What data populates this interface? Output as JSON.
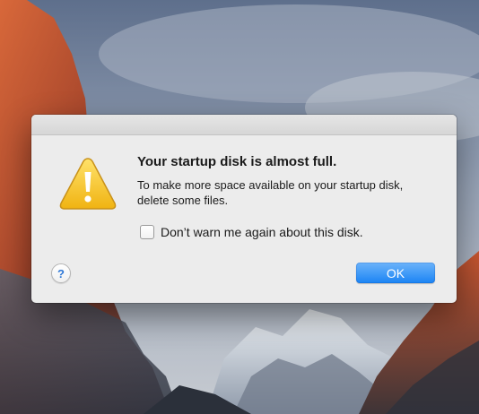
{
  "dialog": {
    "title": "Your startup disk is almost full.",
    "message": "To make more space available on your startup disk, delete some files.",
    "checkbox_label": "Don’t warn me again about this disk.",
    "checkbox_checked": false,
    "help_label": "?",
    "ok_label": "OK",
    "icon": "warning-icon"
  },
  "colors": {
    "dialog_background": "#ececec",
    "ok_button": "#1b84f4",
    "warning_icon": "#f2c21b"
  }
}
